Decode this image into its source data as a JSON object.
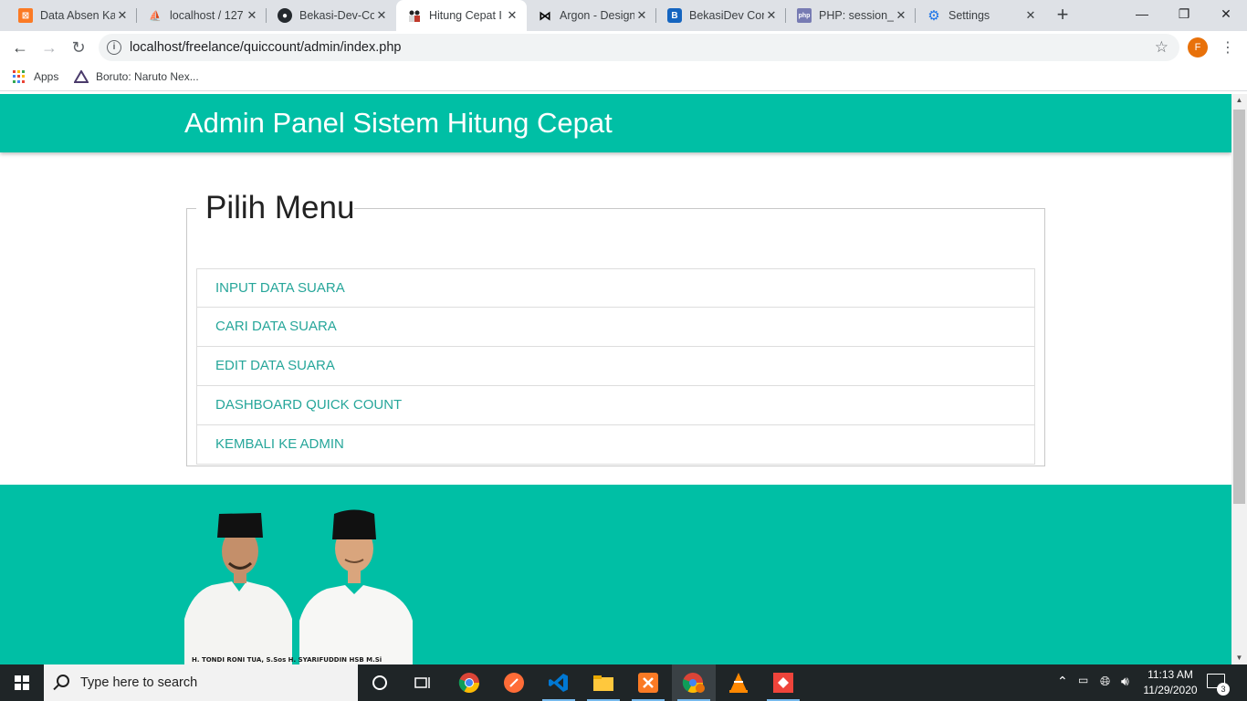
{
  "browser": {
    "tabs": [
      {
        "title": "Data Absen Ka",
        "icon": "xampp-icon",
        "color": "#fb7a24"
      },
      {
        "title": "localhost / 127",
        "icon": "phpmyadmin-icon",
        "color": "#f29111"
      },
      {
        "title": "Bekasi-Dev-Co",
        "icon": "github-icon",
        "color": "#24292e"
      },
      {
        "title": "Hitung Cepat I",
        "icon": "candidate-icon",
        "color": "#c0392b"
      },
      {
        "title": "Argon - Design",
        "icon": "argon-icon",
        "color": "#000000"
      },
      {
        "title": "BekasiDev Con",
        "icon": "bekasidev-icon",
        "color": "#1565c0"
      },
      {
        "title": "PHP: session_u",
        "icon": "php-icon",
        "color": "#777bb3"
      },
      {
        "title": "Settings",
        "icon": "gear-icon",
        "color": "#1a73e8"
      }
    ],
    "active_tab": 3,
    "new_tab_label": "+",
    "window_controls": {
      "minimize": "—",
      "restore": "❐",
      "close": "✕"
    },
    "address": "localhost/freelance/quiccount/admin/index.php",
    "profile_initial": "F",
    "bookmarks": [
      {
        "label": "Apps",
        "icon": "apps-grid-icon"
      },
      {
        "label": "Boruto: Naruto Nex...",
        "icon": "boruto-icon"
      }
    ]
  },
  "page": {
    "header_title": "Admin Panel Sistem Hitung Cepat",
    "menu_legend": "Pilih Menu",
    "menu_items": [
      {
        "label": "INPUT DATA SUARA"
      },
      {
        "label": "CARI DATA SUARA"
      },
      {
        "label": "EDIT DATA SUARA"
      },
      {
        "label": "DASHBOARD QUICK COUNT"
      },
      {
        "label": "KEMBALI KE ADMIN"
      }
    ],
    "candidates_caption": "H. TONDI RONI TUA, S.Sos    H. SYARIFUDDIN HSB M.Si",
    "colors": {
      "primary": "#00bfa5",
      "link": "#26a69a"
    }
  },
  "taskbar": {
    "search_placeholder": "Type here to search",
    "apps": [
      "cortana-icon",
      "task-view-icon",
      "chrome-icon",
      "postman-icon",
      "vscode-icon",
      "file-explorer-icon",
      "xampp-icon",
      "chrome-profile-icon",
      "vlc-icon",
      "anydesk-icon"
    ],
    "time": "11:13 AM",
    "date": "11/29/2020",
    "notification_count": "3"
  }
}
